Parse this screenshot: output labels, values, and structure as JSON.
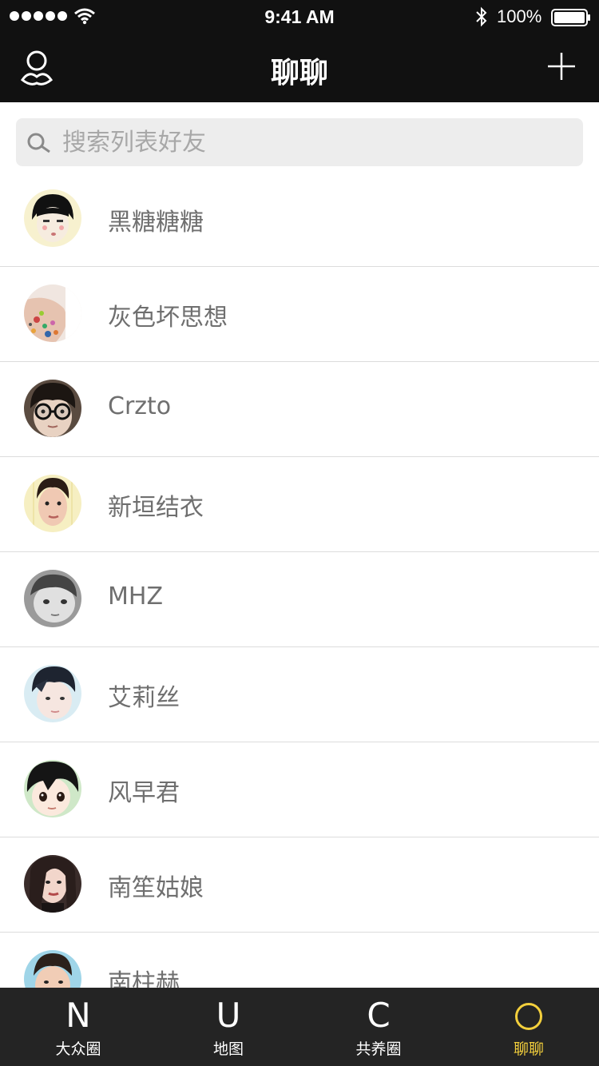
{
  "status_bar": {
    "time": "9:41 AM",
    "battery_percent": "100%",
    "icons": [
      "signal-dots",
      "wifi-icon",
      "bluetooth-icon",
      "battery-icon"
    ]
  },
  "nav": {
    "title": "聊聊",
    "left_icon": "profile-icon",
    "right_icon": "plus-icon"
  },
  "search": {
    "placeholder": "搜索列表好友",
    "icon": "search-icon"
  },
  "contacts": [
    {
      "name": "黑糖糖糖"
    },
    {
      "name": "灰色坏思想"
    },
    {
      "name": "Crzto"
    },
    {
      "name": "新垣结衣"
    },
    {
      "name": "MHZ"
    },
    {
      "name": "艾莉丝"
    },
    {
      "name": "风早君"
    },
    {
      "name": "南笙姑娘"
    },
    {
      "name": "南柱赫"
    }
  ],
  "tabs": [
    {
      "glyph": "N",
      "label": "大众圈",
      "active": false
    },
    {
      "glyph": "U",
      "label": "地图",
      "active": false
    },
    {
      "glyph": "C",
      "label": "共养圈",
      "active": false
    },
    {
      "glyph": "circle-icon",
      "label": "聊聊",
      "active": true
    }
  ],
  "colors": {
    "header_bg": "#111111",
    "tabbar_bg": "#242424",
    "accent": "#f3cf3c",
    "name_text": "#6f6f6f"
  }
}
